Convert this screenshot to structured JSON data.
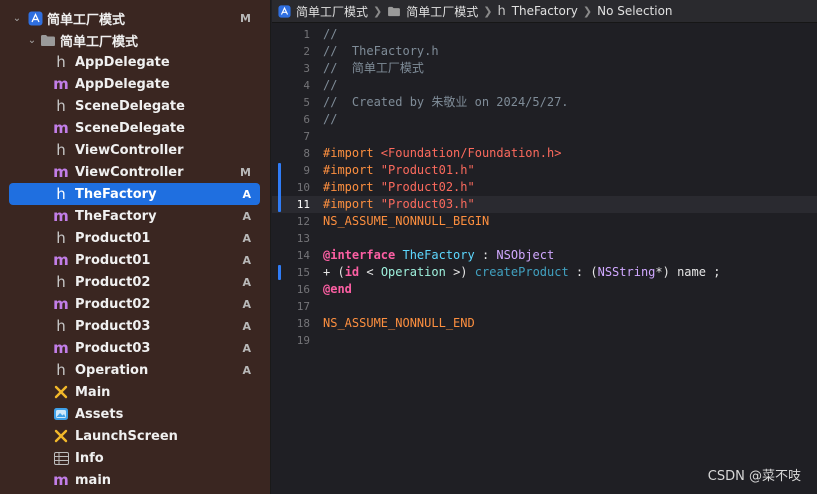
{
  "navigator": {
    "project": {
      "label": "简单工厂模式",
      "status": "M"
    },
    "group": {
      "label": "简单工厂模式"
    },
    "files": [
      {
        "label": "AppDelegate",
        "kind": "h",
        "status": ""
      },
      {
        "label": "AppDelegate",
        "kind": "m",
        "status": ""
      },
      {
        "label": "SceneDelegate",
        "kind": "h",
        "status": ""
      },
      {
        "label": "SceneDelegate",
        "kind": "m",
        "status": ""
      },
      {
        "label": "ViewController",
        "kind": "h",
        "status": ""
      },
      {
        "label": "ViewController",
        "kind": "m",
        "status": "M"
      },
      {
        "label": "TheFactory",
        "kind": "h",
        "status": "A"
      },
      {
        "label": "TheFactory",
        "kind": "m",
        "status": "A"
      },
      {
        "label": "Product01",
        "kind": "h",
        "status": "A"
      },
      {
        "label": "Product01",
        "kind": "m",
        "status": "A"
      },
      {
        "label": "Product02",
        "kind": "h",
        "status": "A"
      },
      {
        "label": "Product02",
        "kind": "m",
        "status": "A"
      },
      {
        "label": "Product03",
        "kind": "h",
        "status": "A"
      },
      {
        "label": "Product03",
        "kind": "m",
        "status": "A"
      },
      {
        "label": "Operation",
        "kind": "h",
        "status": "A"
      },
      {
        "label": "Main",
        "kind": "storyboard",
        "status": ""
      },
      {
        "label": "Assets",
        "kind": "assets",
        "status": ""
      },
      {
        "label": "LaunchScreen",
        "kind": "storyboard",
        "status": ""
      },
      {
        "label": "Info",
        "kind": "plist",
        "status": ""
      },
      {
        "label": "main",
        "kind": "m",
        "status": ""
      }
    ]
  },
  "jumpbar": {
    "project": "简单工厂模式",
    "group": "简单工厂模式",
    "file": "TheFactory",
    "selection": "No Selection"
  },
  "editor": {
    "current_line": 11,
    "lines": [
      {
        "n": "1",
        "tokens": [
          {
            "t": "//",
            "c": "comment"
          }
        ]
      },
      {
        "n": "2",
        "tokens": [
          {
            "t": "//  TheFactory.h",
            "c": "comment"
          }
        ]
      },
      {
        "n": "3",
        "tokens": [
          {
            "t": "//  简单工厂模式",
            "c": "comment"
          }
        ]
      },
      {
        "n": "4",
        "tokens": [
          {
            "t": "//",
            "c": "comment"
          }
        ]
      },
      {
        "n": "5",
        "tokens": [
          {
            "t": "//  Created by 朱敬业 on 2024/5/27.",
            "c": "comment"
          }
        ]
      },
      {
        "n": "6",
        "tokens": [
          {
            "t": "//",
            "c": "comment"
          }
        ]
      },
      {
        "n": "7",
        "tokens": []
      },
      {
        "n": "8",
        "tokens": [
          {
            "t": "#import ",
            "c": "pre"
          },
          {
            "t": "<Foundation/Foundation.h>",
            "c": "str"
          }
        ]
      },
      {
        "n": "9",
        "tokens": [
          {
            "t": "#import ",
            "c": "pre"
          },
          {
            "t": "\"Product01.h\"",
            "c": "str"
          }
        ]
      },
      {
        "n": "10",
        "tokens": [
          {
            "t": "#import ",
            "c": "pre"
          },
          {
            "t": "\"Product02.h\"",
            "c": "str"
          }
        ]
      },
      {
        "n": "11",
        "tokens": [
          {
            "t": "#import ",
            "c": "pre"
          },
          {
            "t": "\"Product03.h\"",
            "c": "str"
          }
        ]
      },
      {
        "n": "12",
        "tokens": [
          {
            "t": "NS_ASSUME_NONNULL_BEGIN",
            "c": "pre"
          }
        ]
      },
      {
        "n": "13",
        "tokens": []
      },
      {
        "n": "14",
        "tokens": [
          {
            "t": "@interface ",
            "c": "kw"
          },
          {
            "t": "TheFactory",
            "c": "type"
          },
          {
            "t": " : ",
            "c": "plain"
          },
          {
            "t": "NSObject",
            "c": "cls"
          }
        ]
      },
      {
        "n": "15",
        "tokens": [
          {
            "t": "+ (",
            "c": "plain"
          },
          {
            "t": "id",
            "c": "kw"
          },
          {
            "t": " < ",
            "c": "plain"
          },
          {
            "t": "Operation",
            "c": "ptype"
          },
          {
            "t": " >) ",
            "c": "plain"
          },
          {
            "t": "createProduct",
            "c": "fn"
          },
          {
            "t": " : (",
            "c": "plain"
          },
          {
            "t": "NSString",
            "c": "cls"
          },
          {
            "t": "*) name ;",
            "c": "plain"
          }
        ]
      },
      {
        "n": "16",
        "tokens": [
          {
            "t": "@end",
            "c": "kw"
          }
        ]
      },
      {
        "n": "17",
        "tokens": []
      },
      {
        "n": "18",
        "tokens": [
          {
            "t": "NS_ASSUME_NONNULL_END",
            "c": "pre"
          }
        ]
      },
      {
        "n": "19",
        "tokens": []
      }
    ]
  },
  "watermark": "CSDN @菜不吱",
  "colors": {
    "sidebar_bg": "#3a2621",
    "selection": "#1f6fe0",
    "editor_bg": "#1f1f24",
    "change_bar": "#2f7cf6"
  }
}
